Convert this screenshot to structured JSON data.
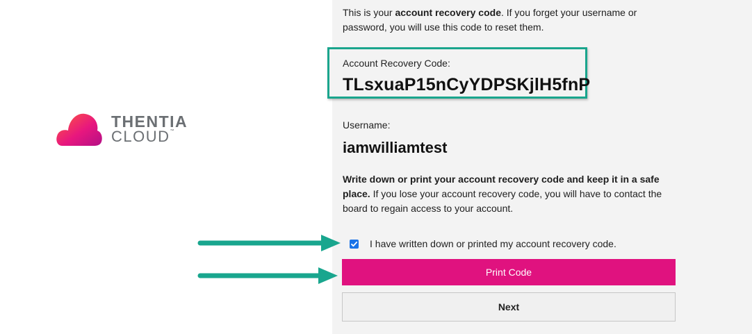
{
  "logo": {
    "line1": "THENTIA",
    "line2": "CLOUD",
    "trademark": "™",
    "icon": "cloud-logo-icon"
  },
  "intro": {
    "prefix": "This is your ",
    "bold": "account recovery code",
    "suffix": ". If you forget your username or password, you will use this code to reset them."
  },
  "recovery": {
    "label": "Account Recovery Code:",
    "code": "TLsxuaP15nCyYDPSKjlH5fnP"
  },
  "user": {
    "label": "Username:",
    "value": "iamwilliamtest"
  },
  "note": {
    "bold": "Write down or print your account recovery code and keep it in a safe place.",
    "rest": " If you lose your account recovery code, you will have to contact the board to regain access to your account."
  },
  "confirm": {
    "label": "I have written down or printed my account recovery code.",
    "checked": true
  },
  "buttons": {
    "print": "Print Code",
    "next": "Next"
  },
  "colors": {
    "accent": "#e0127f",
    "highlight": "#1aa58d",
    "checkbox": "#1a73e8"
  }
}
